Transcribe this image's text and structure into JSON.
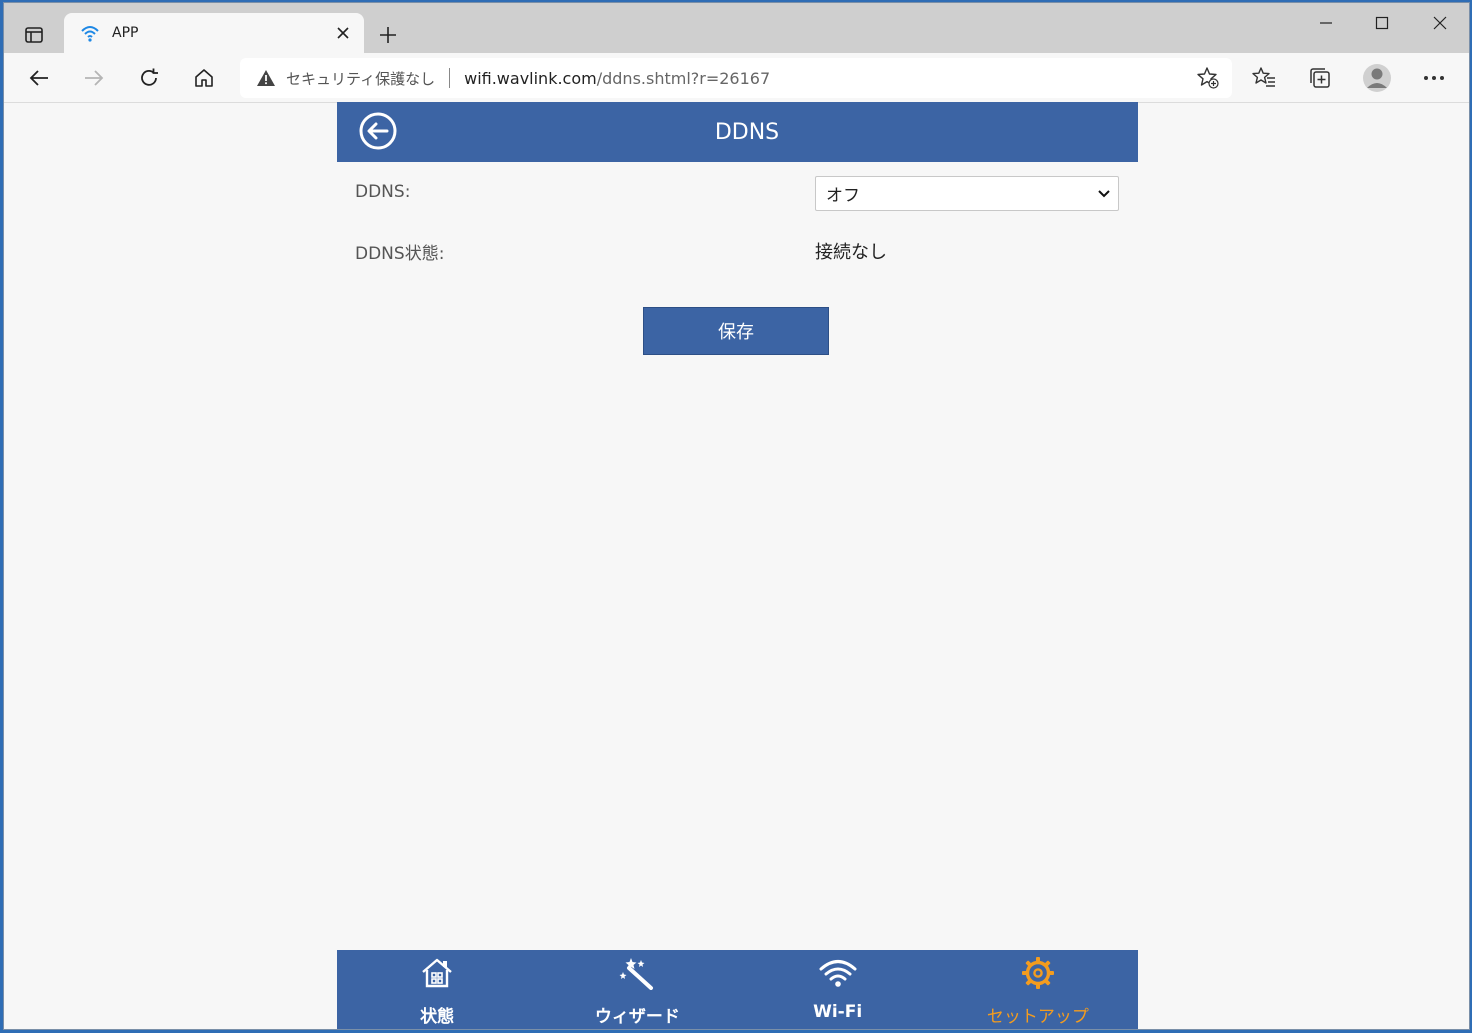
{
  "browser": {
    "tab_title": "APP",
    "address": {
      "security_text": "セキュリティ保護なし",
      "url_host": "wifi.wavlink.com",
      "url_path": "/ddns.shtml?r=26167"
    }
  },
  "page": {
    "title": "DDNS",
    "ddns_label": "DDNS:",
    "ddns_select_value": "オフ",
    "status_label": "DDNS状態:",
    "status_value": "接続なし",
    "save_label": "保存"
  },
  "bottom_nav": {
    "items": [
      {
        "label": "状態",
        "icon": "home-icon"
      },
      {
        "label": "ウィザード",
        "icon": "wand-icon"
      },
      {
        "label": "Wi-Fi",
        "icon": "wifi-icon"
      },
      {
        "label": "セットアップ",
        "icon": "gear-icon"
      }
    ],
    "active_color": "#f39c1f"
  },
  "colors": {
    "brand": "#3c64a4"
  }
}
